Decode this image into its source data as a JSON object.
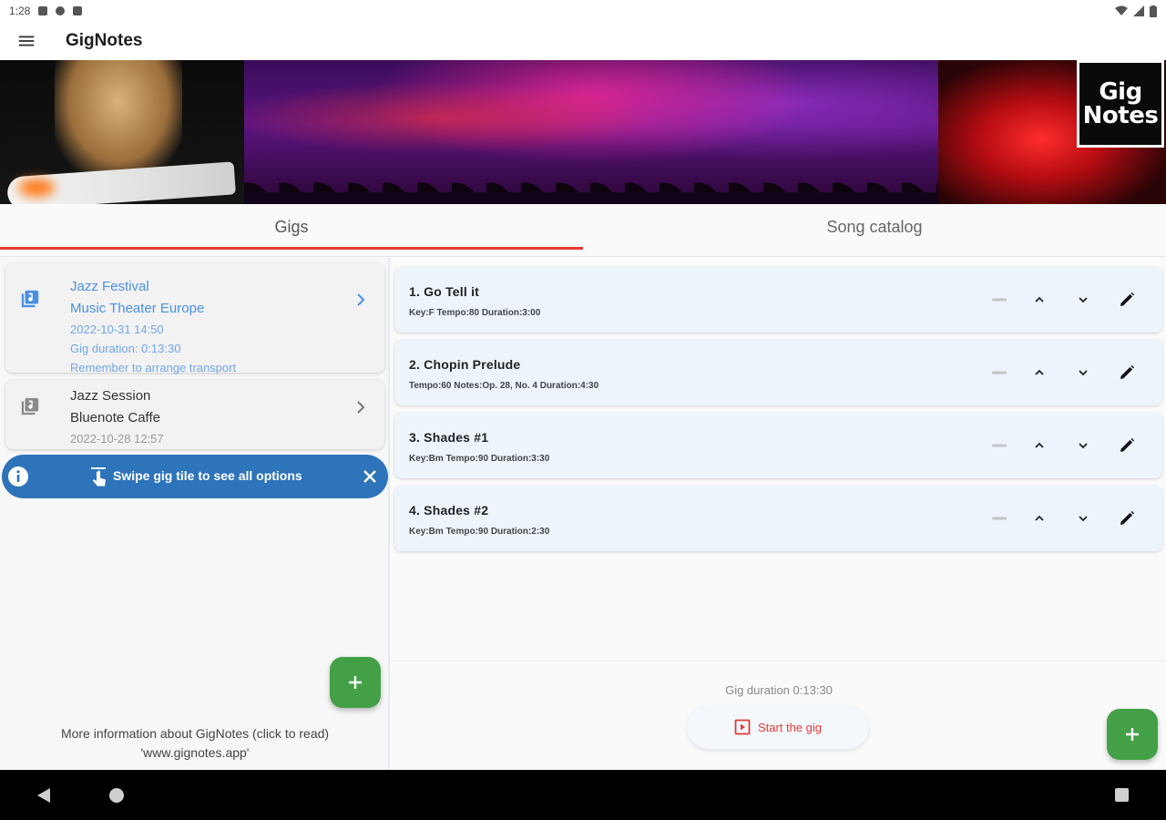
{
  "status_bar": {
    "time": "1:28"
  },
  "app": {
    "title": "GigNotes"
  },
  "banner": {
    "logo_line1": "Gig",
    "logo_line2": "Notes"
  },
  "tabs": [
    {
      "label": "Gigs",
      "active": true
    },
    {
      "label": "Song catalog",
      "active": false
    }
  ],
  "gigs": [
    {
      "title": "Jazz Festival",
      "venue": "Music Theater Europe",
      "datetime": "2022-10-31 14:50",
      "duration": "Gig duration: 0:13:30",
      "note": "Remember to arrange transport",
      "selected": true
    },
    {
      "title": "Jazz Session",
      "venue": "Bluenote Caffe",
      "datetime": "2022-10-28 12:57",
      "selected": false
    }
  ],
  "hint": {
    "text": "Swipe gig tile to see all options"
  },
  "more_info": {
    "line1": "More information about GigNotes (click to read)",
    "line2": "'www.gignotes.app'"
  },
  "songs": [
    {
      "title": "1. Go Tell it",
      "details": "Key:F  Tempo:80  Duration:3:00"
    },
    {
      "title": "2. Chopin Prelude",
      "details": "Tempo:60  Notes:Op. 28, No. 4  Duration:4:30"
    },
    {
      "title": "3.  Shades #1",
      "details": "Key:Bm  Tempo:90  Duration:3:30"
    },
    {
      "title": "4. Shades #2",
      "details": "Key:Bm  Tempo:90  Duration:2:30"
    }
  ],
  "footer": {
    "gig_duration": "Gig duration 0:13:30",
    "start_label": "Start the gig"
  },
  "colors": {
    "accent": "#e53935",
    "fab": "#43a047",
    "hint_bg": "#2e74ba",
    "link_blue": "#4a90e2"
  }
}
